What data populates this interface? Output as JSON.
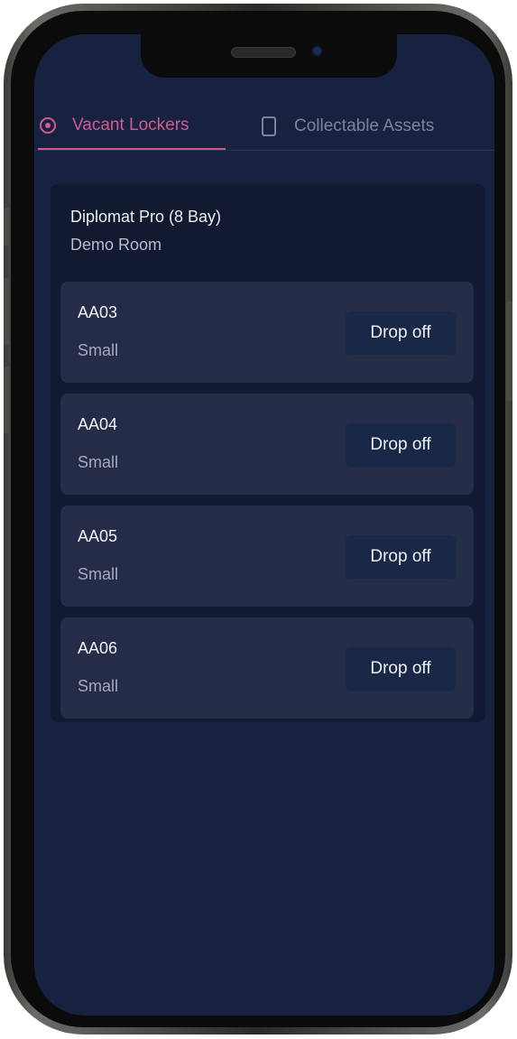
{
  "tabs": [
    {
      "label": "Vacant Lockers",
      "icon": "radio-target-icon",
      "active": true
    },
    {
      "label": "Collectable Assets",
      "icon": "tablet-icon",
      "active": false
    }
  ],
  "room": {
    "title": "Diplomat Pro (8 Bay)",
    "subtitle": "Demo Room"
  },
  "lockers": [
    {
      "id": "AA03",
      "size": "Small",
      "action": "Drop off"
    },
    {
      "id": "AA04",
      "size": "Small",
      "action": "Drop off"
    },
    {
      "id": "AA05",
      "size": "Small",
      "action": "Drop off"
    },
    {
      "id": "AA06",
      "size": "Small",
      "action": "Drop off"
    }
  ],
  "colors": {
    "accent": "#d05a8e",
    "background": "#172240",
    "card": "#252c48"
  }
}
